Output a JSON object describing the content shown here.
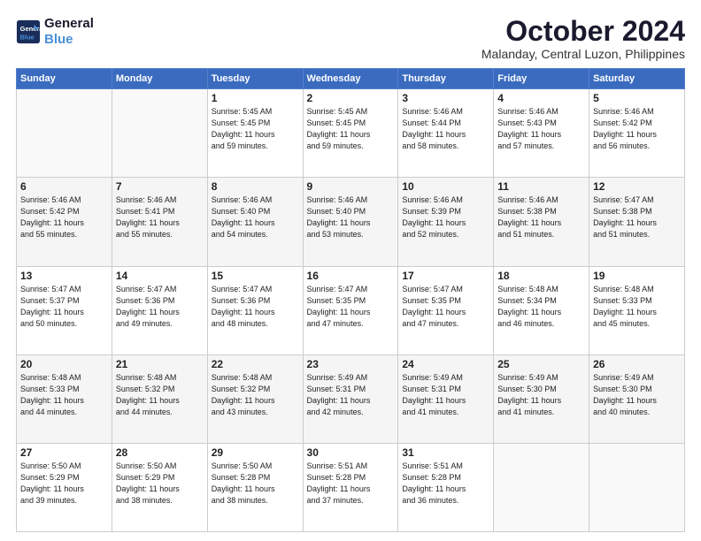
{
  "header": {
    "logo_line1": "General",
    "logo_line2": "Blue",
    "month": "October 2024",
    "location": "Malanday, Central Luzon, Philippines"
  },
  "weekdays": [
    "Sunday",
    "Monday",
    "Tuesday",
    "Wednesday",
    "Thursday",
    "Friday",
    "Saturday"
  ],
  "rows": [
    [
      {
        "num": "",
        "info": ""
      },
      {
        "num": "",
        "info": ""
      },
      {
        "num": "1",
        "info": "Sunrise: 5:45 AM\nSunset: 5:45 PM\nDaylight: 11 hours\nand 59 minutes."
      },
      {
        "num": "2",
        "info": "Sunrise: 5:45 AM\nSunset: 5:45 PM\nDaylight: 11 hours\nand 59 minutes."
      },
      {
        "num": "3",
        "info": "Sunrise: 5:46 AM\nSunset: 5:44 PM\nDaylight: 11 hours\nand 58 minutes."
      },
      {
        "num": "4",
        "info": "Sunrise: 5:46 AM\nSunset: 5:43 PM\nDaylight: 11 hours\nand 57 minutes."
      },
      {
        "num": "5",
        "info": "Sunrise: 5:46 AM\nSunset: 5:42 PM\nDaylight: 11 hours\nand 56 minutes."
      }
    ],
    [
      {
        "num": "6",
        "info": "Sunrise: 5:46 AM\nSunset: 5:42 PM\nDaylight: 11 hours\nand 55 minutes."
      },
      {
        "num": "7",
        "info": "Sunrise: 5:46 AM\nSunset: 5:41 PM\nDaylight: 11 hours\nand 55 minutes."
      },
      {
        "num": "8",
        "info": "Sunrise: 5:46 AM\nSunset: 5:40 PM\nDaylight: 11 hours\nand 54 minutes."
      },
      {
        "num": "9",
        "info": "Sunrise: 5:46 AM\nSunset: 5:40 PM\nDaylight: 11 hours\nand 53 minutes."
      },
      {
        "num": "10",
        "info": "Sunrise: 5:46 AM\nSunset: 5:39 PM\nDaylight: 11 hours\nand 52 minutes."
      },
      {
        "num": "11",
        "info": "Sunrise: 5:46 AM\nSunset: 5:38 PM\nDaylight: 11 hours\nand 51 minutes."
      },
      {
        "num": "12",
        "info": "Sunrise: 5:47 AM\nSunset: 5:38 PM\nDaylight: 11 hours\nand 51 minutes."
      }
    ],
    [
      {
        "num": "13",
        "info": "Sunrise: 5:47 AM\nSunset: 5:37 PM\nDaylight: 11 hours\nand 50 minutes."
      },
      {
        "num": "14",
        "info": "Sunrise: 5:47 AM\nSunset: 5:36 PM\nDaylight: 11 hours\nand 49 minutes."
      },
      {
        "num": "15",
        "info": "Sunrise: 5:47 AM\nSunset: 5:36 PM\nDaylight: 11 hours\nand 48 minutes."
      },
      {
        "num": "16",
        "info": "Sunrise: 5:47 AM\nSunset: 5:35 PM\nDaylight: 11 hours\nand 47 minutes."
      },
      {
        "num": "17",
        "info": "Sunrise: 5:47 AM\nSunset: 5:35 PM\nDaylight: 11 hours\nand 47 minutes."
      },
      {
        "num": "18",
        "info": "Sunrise: 5:48 AM\nSunset: 5:34 PM\nDaylight: 11 hours\nand 46 minutes."
      },
      {
        "num": "19",
        "info": "Sunrise: 5:48 AM\nSunset: 5:33 PM\nDaylight: 11 hours\nand 45 minutes."
      }
    ],
    [
      {
        "num": "20",
        "info": "Sunrise: 5:48 AM\nSunset: 5:33 PM\nDaylight: 11 hours\nand 44 minutes."
      },
      {
        "num": "21",
        "info": "Sunrise: 5:48 AM\nSunset: 5:32 PM\nDaylight: 11 hours\nand 44 minutes."
      },
      {
        "num": "22",
        "info": "Sunrise: 5:48 AM\nSunset: 5:32 PM\nDaylight: 11 hours\nand 43 minutes."
      },
      {
        "num": "23",
        "info": "Sunrise: 5:49 AM\nSunset: 5:31 PM\nDaylight: 11 hours\nand 42 minutes."
      },
      {
        "num": "24",
        "info": "Sunrise: 5:49 AM\nSunset: 5:31 PM\nDaylight: 11 hours\nand 41 minutes."
      },
      {
        "num": "25",
        "info": "Sunrise: 5:49 AM\nSunset: 5:30 PM\nDaylight: 11 hours\nand 41 minutes."
      },
      {
        "num": "26",
        "info": "Sunrise: 5:49 AM\nSunset: 5:30 PM\nDaylight: 11 hours\nand 40 minutes."
      }
    ],
    [
      {
        "num": "27",
        "info": "Sunrise: 5:50 AM\nSunset: 5:29 PM\nDaylight: 11 hours\nand 39 minutes."
      },
      {
        "num": "28",
        "info": "Sunrise: 5:50 AM\nSunset: 5:29 PM\nDaylight: 11 hours\nand 38 minutes."
      },
      {
        "num": "29",
        "info": "Sunrise: 5:50 AM\nSunset: 5:28 PM\nDaylight: 11 hours\nand 38 minutes."
      },
      {
        "num": "30",
        "info": "Sunrise: 5:51 AM\nSunset: 5:28 PM\nDaylight: 11 hours\nand 37 minutes."
      },
      {
        "num": "31",
        "info": "Sunrise: 5:51 AM\nSunset: 5:28 PM\nDaylight: 11 hours\nand 36 minutes."
      },
      {
        "num": "",
        "info": ""
      },
      {
        "num": "",
        "info": ""
      }
    ]
  ]
}
